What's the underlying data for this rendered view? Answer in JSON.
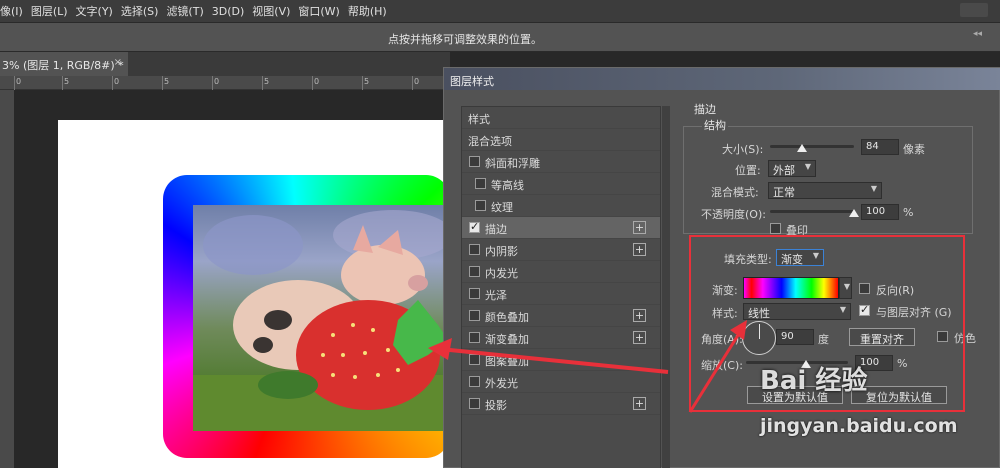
{
  "menubar": {
    "items": [
      "像(I)",
      "图层(L)",
      "文字(Y)",
      "选择(S)",
      "滤镜(T)",
      "3D(D)",
      "视图(V)",
      "窗口(W)",
      "帮助(H)"
    ]
  },
  "options": {
    "hint": "点按并拖移可调整效果的位置。"
  },
  "document": {
    "tab_title": "3% (图层 1, RGB/8#) *",
    "tab_close": "×",
    "ruler_labels": [
      "0",
      "5",
      "0",
      "5",
      "0",
      "5",
      "0",
      "5",
      "0"
    ]
  },
  "dialog": {
    "title": "图层样式",
    "styles": [
      {
        "label": "样式",
        "checkbox": false,
        "checked": false,
        "plus": false
      },
      {
        "label": "混合选项",
        "checkbox": false,
        "checked": false,
        "plus": false
      },
      {
        "label": "斜面和浮雕",
        "checkbox": true,
        "checked": false,
        "plus": false
      },
      {
        "label": "等高线",
        "checkbox": true,
        "checked": false,
        "plus": false,
        "indent": true
      },
      {
        "label": "纹理",
        "checkbox": true,
        "checked": false,
        "plus": false,
        "indent": true
      },
      {
        "label": "描边",
        "checkbox": true,
        "checked": true,
        "plus": true,
        "selected": true
      },
      {
        "label": "内阴影",
        "checkbox": true,
        "checked": false,
        "plus": true
      },
      {
        "label": "内发光",
        "checkbox": true,
        "checked": false,
        "plus": false
      },
      {
        "label": "光泽",
        "checkbox": true,
        "checked": false,
        "plus": false
      },
      {
        "label": "颜色叠加",
        "checkbox": true,
        "checked": false,
        "plus": true
      },
      {
        "label": "渐变叠加",
        "checkbox": true,
        "checked": false,
        "plus": true
      },
      {
        "label": "图案叠加",
        "checkbox": true,
        "checked": false,
        "plus": false
      },
      {
        "label": "外发光",
        "checkbox": true,
        "checked": false,
        "plus": false
      },
      {
        "label": "投影",
        "checkbox": true,
        "checked": false,
        "plus": true
      }
    ],
    "stroke": {
      "section": "描边",
      "structure": "结构",
      "size_label": "大小(S):",
      "size_value": "84",
      "size_unit": "像素",
      "size_level": 0.2,
      "position_label": "位置:",
      "position_value": "外部",
      "blend_label": "混合模式:",
      "blend_value": "正常",
      "opacity_label": "不透明度(O):",
      "opacity_value": "100",
      "opacity_unit": "%",
      "overprint_label": "叠印",
      "fill_type_label": "填充类型:",
      "fill_type_value": "渐变",
      "gradient_label": "渐变:",
      "reverse_label": "反向(R)",
      "style_label": "样式:",
      "style_value": "线性",
      "align_label": "与图层对齐 (G)",
      "angle_label": "角度(A):",
      "angle_value": "90",
      "angle_unit": "度",
      "reset_align_label": "重置对齐",
      "dither_label": "仿色",
      "scale_label": "缩放(C):",
      "scale_value": "100",
      "scale_unit": "%",
      "set_default_label": "设置为默认值",
      "reset_default_label": "复位为默认值"
    }
  },
  "watermark": {
    "logo": "Bai 经验",
    "url": "jingyan.baidu.com"
  },
  "colors": {
    "highlight": "#e8303a",
    "panel": "#535353"
  }
}
